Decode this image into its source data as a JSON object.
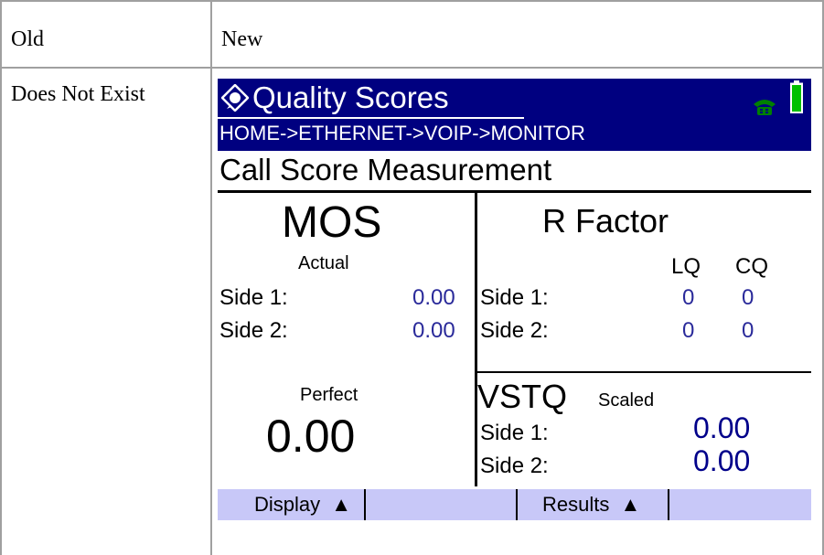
{
  "table": {
    "header_old": "Old",
    "header_new": "New",
    "row_old": "Does Not Exist"
  },
  "screen": {
    "title": "Quality Scores",
    "breadcrumb": "HOME->ETHERNET->VOIP->MONITOR",
    "section_title": "Call Score Measurement",
    "icons": {
      "title": "quality-scores-icon",
      "phone": "phone-icon",
      "battery": "battery-icon"
    },
    "mos": {
      "heading": "MOS",
      "subheading": "Actual",
      "side1_label": "Side 1:",
      "side1_value": "0.00",
      "side2_label": "Side 2:",
      "side2_value": "0.00",
      "perfect_label": "Perfect",
      "perfect_value": "0.00"
    },
    "rfactor": {
      "heading": "R Factor",
      "col_lq": "LQ",
      "col_cq": "CQ",
      "side1_label": "Side 1:",
      "side1_lq": "0",
      "side1_cq": "0",
      "side2_label": "Side 2:",
      "side2_lq": "0",
      "side2_cq": "0"
    },
    "vstq": {
      "heading": "VSTQ",
      "subheading": "Scaled",
      "side1_label": "Side 1:",
      "side1_value": "0.00",
      "side2_label": "Side 2:",
      "side2_value": "0.00"
    },
    "softkeys": {
      "display": "Display",
      "results": "Results",
      "arrow": "▲"
    },
    "colors": {
      "titlebar": "#000080",
      "softbar": "#c8c8f8",
      "value_blue": "#2a2a9a",
      "phone_green": "#008000",
      "battery_green": "#00c000"
    }
  }
}
